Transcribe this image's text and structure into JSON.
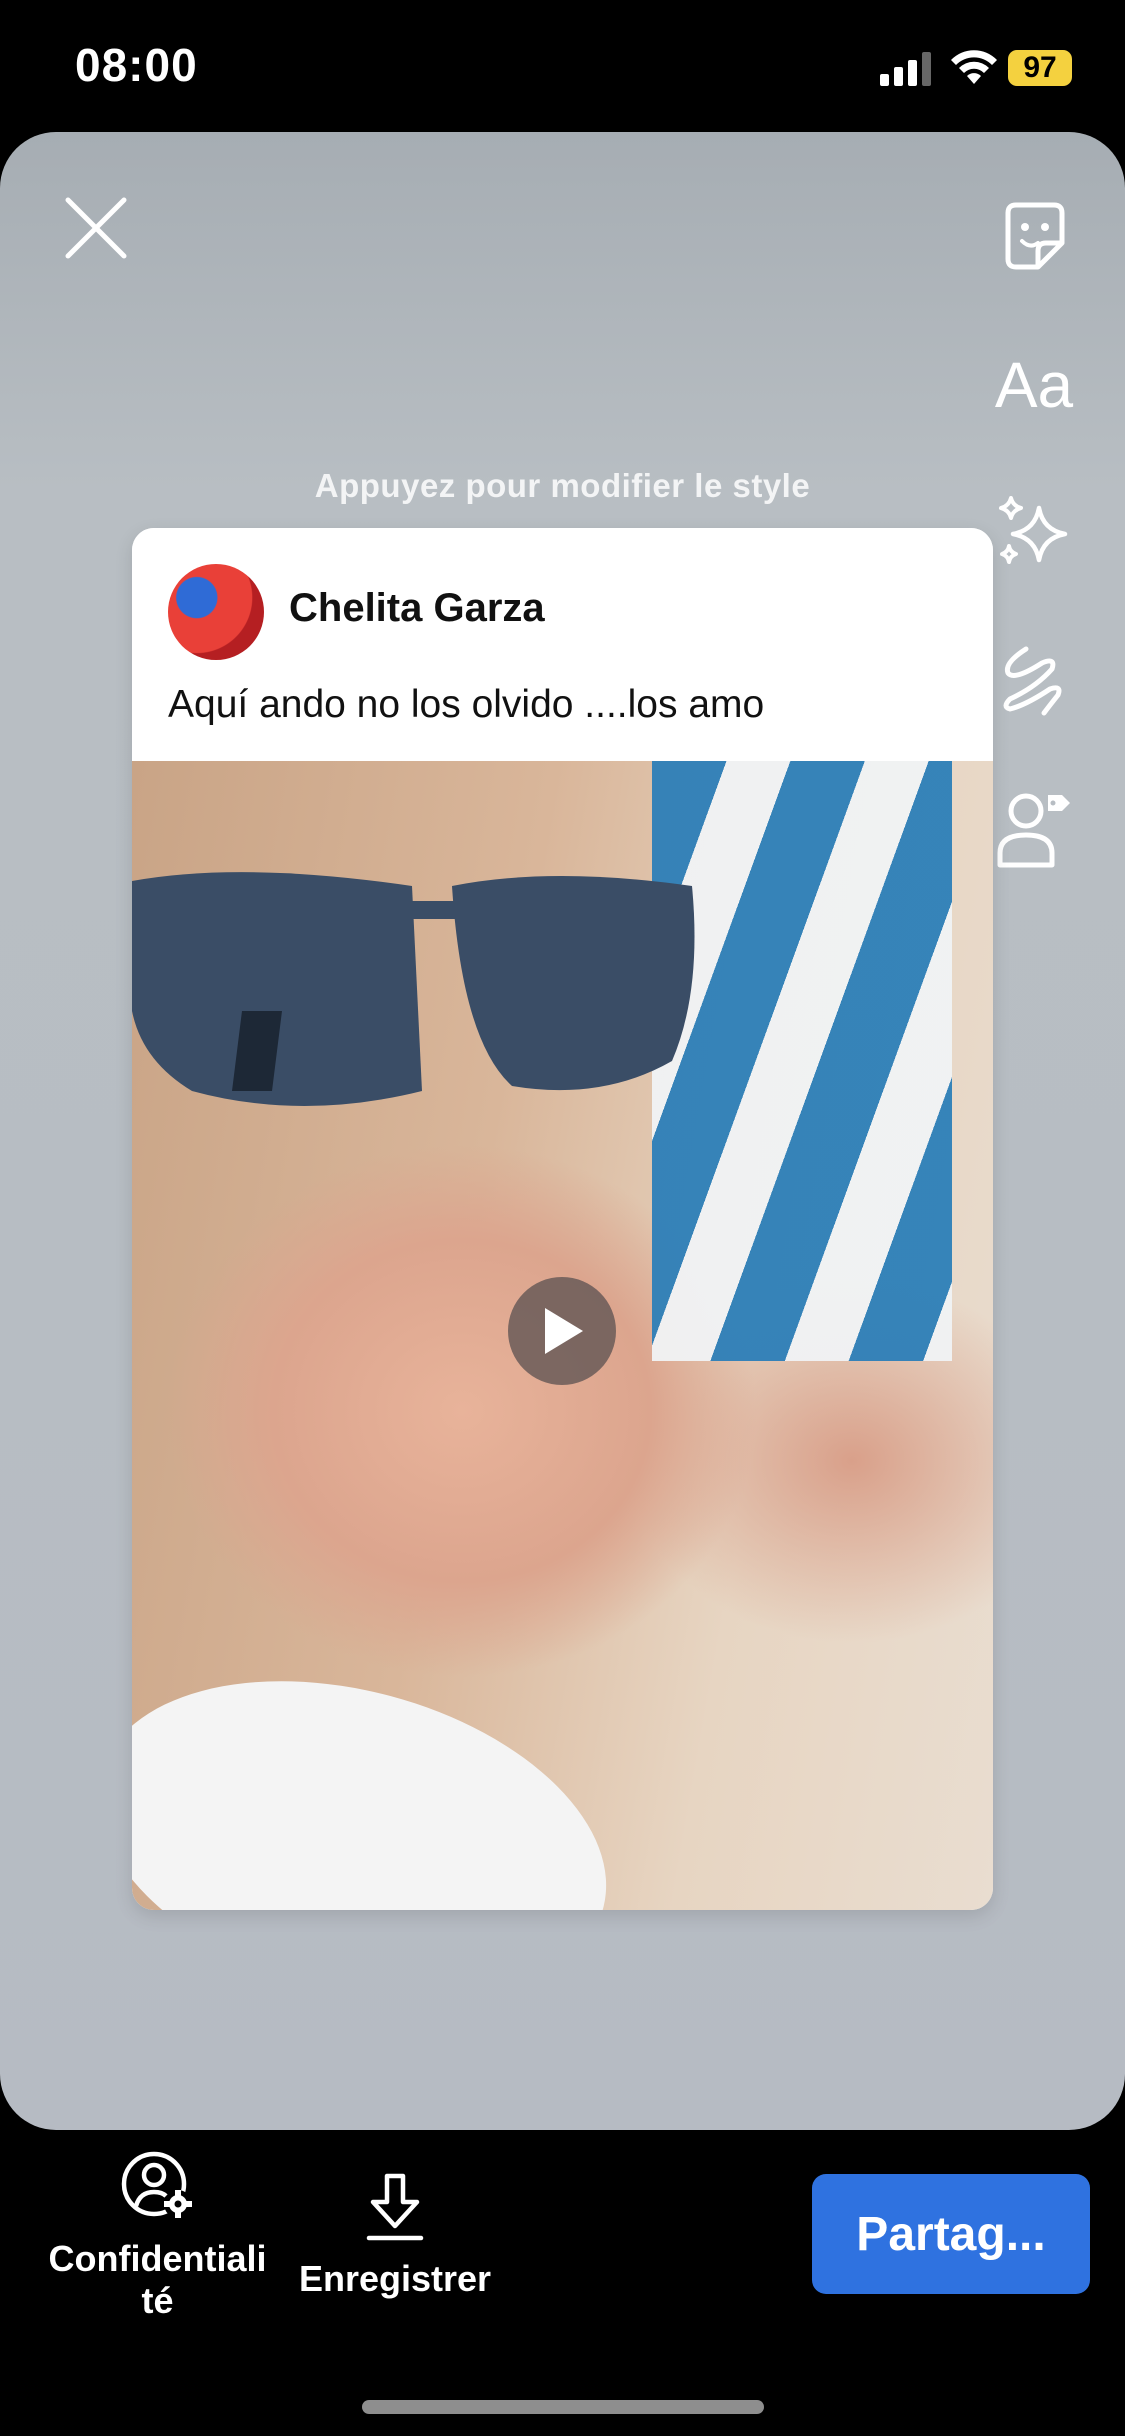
{
  "status_bar": {
    "time": "08:00",
    "battery": "97"
  },
  "editor": {
    "hint": "Appuyez pour modifier le style",
    "tools": {
      "text_label": "Aa",
      "icons": [
        "sticker-icon",
        "text-icon",
        "effects-icon",
        "draw-icon",
        "tag-people-icon"
      ]
    }
  },
  "post": {
    "author": "Chelita Garza",
    "text": "Aquí ando no los olvido ....los amo"
  },
  "bottom_bar": {
    "privacy_label_line1": "Confidentiali",
    "privacy_label_line2": "té",
    "save_label": "Enregistrer",
    "share_label": "Partag..."
  },
  "colors": {
    "share_button": "#2f72e0",
    "battery": "#f4d13f"
  }
}
